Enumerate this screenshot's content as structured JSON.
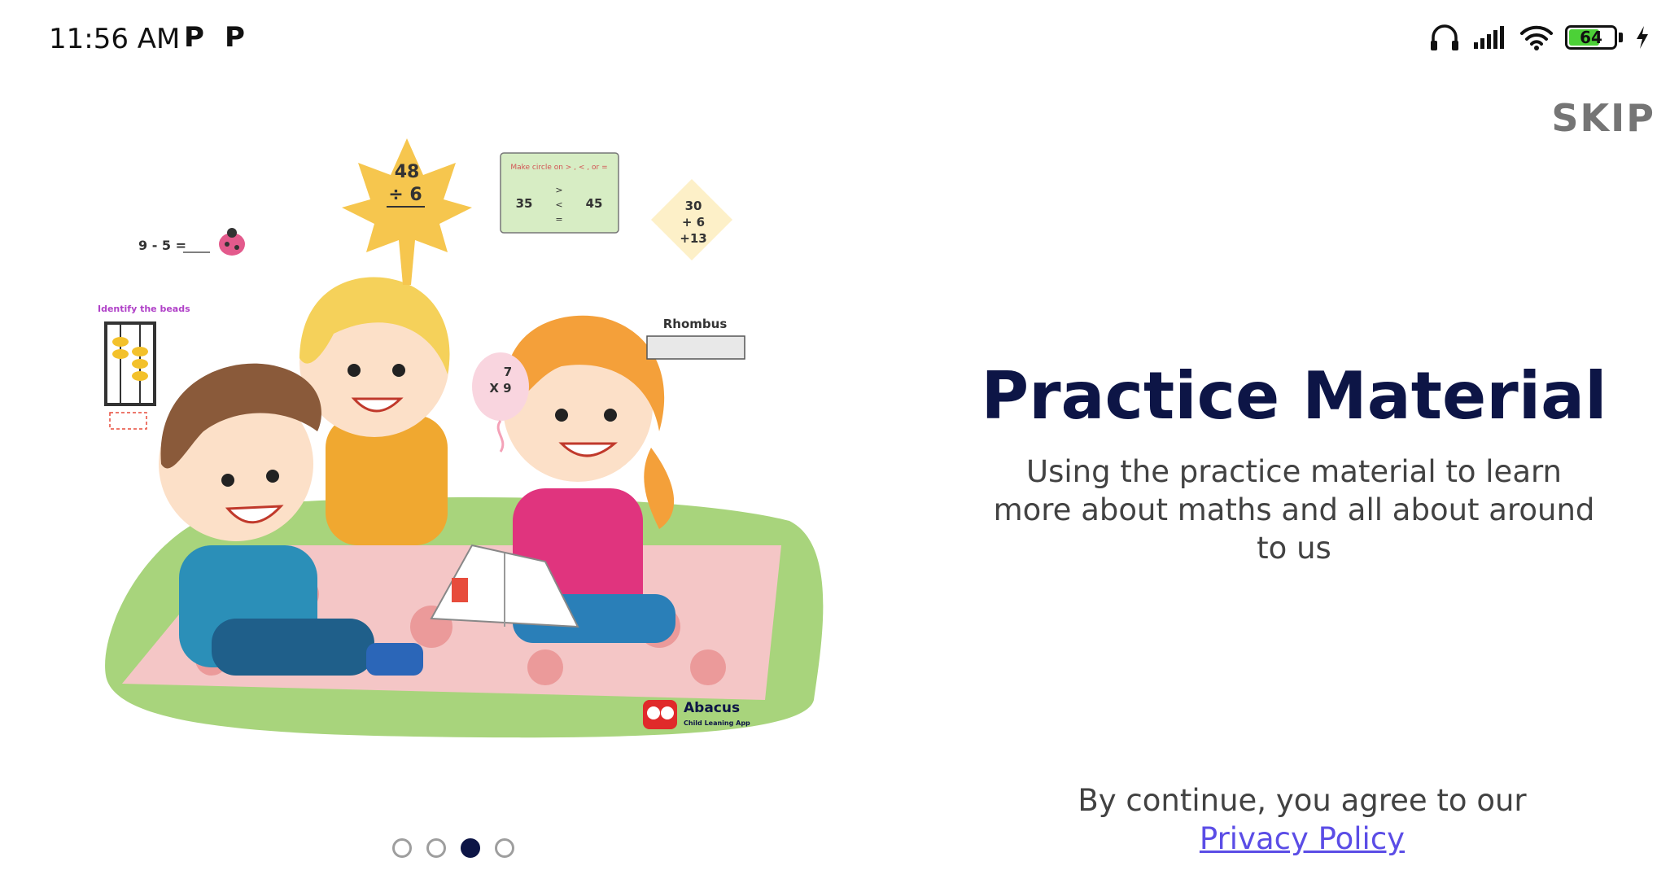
{
  "status_bar": {
    "time": "11:56 AM",
    "notification_icons": [
      "P",
      "P"
    ],
    "battery_level": "64",
    "icons": [
      "headset-icon",
      "signal-icon",
      "wifi-icon",
      "battery-icon",
      "charging-icon"
    ]
  },
  "skip_label": "SKIP",
  "title": "Practice Material",
  "subtitle": "Using the practice material to learn more about maths and all about around to us",
  "consent_text": "By continue, you agree to our",
  "privacy_link": "Privacy Policy",
  "pagination": {
    "total": 4,
    "active_index": 3
  },
  "illustration": {
    "leaf_problem": [
      "48",
      "÷ 6"
    ],
    "subtraction": "9 - 5 =",
    "compare_card": {
      "instruction": "Make circle on > , < , or =",
      "left": "35",
      "symbols": [
        ">",
        "<",
        "="
      ],
      "right": "45"
    },
    "diamond": [
      "30",
      "+ 6",
      "+13"
    ],
    "shape_label": "Rhombus",
    "beads_label": "Identify the beads",
    "balloon": [
      "7",
      "X 9"
    ],
    "brand_name": "Abacus",
    "brand_tagline": "Child Leaning App"
  },
  "colors": {
    "title": "#0d1546",
    "link": "#5b4de6",
    "skip": "#757575",
    "active_dot": "#0d1546"
  }
}
